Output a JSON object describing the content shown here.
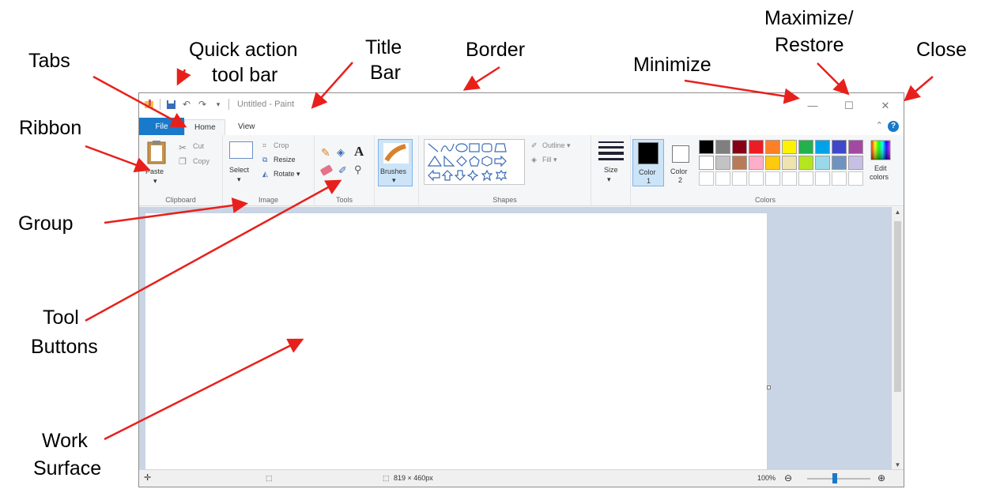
{
  "annotations": {
    "tabs": "Tabs",
    "quick_access_line1": "Quick action",
    "quick_access_line2": "tool bar",
    "title_bar_line1": "Title",
    "title_bar_line2": "Bar",
    "border": "Border",
    "minimize": "Minimize",
    "maximize_line1": "Maximize/",
    "maximize_line2": "Restore",
    "close": "Close",
    "ribbon": "Ribbon",
    "group": "Group",
    "tool_buttons_line1": "Tool",
    "tool_buttons_line2": "Buttons",
    "work_surface_line1": "Work",
    "work_surface_line2": "Surface"
  },
  "window": {
    "title": "Untitled - Paint",
    "minimize_glyph": "—",
    "maximize_glyph": "☐",
    "close_glyph": "✕"
  },
  "tabs": {
    "file": "File",
    "home": "Home",
    "view": "View"
  },
  "ribbon": {
    "clipboard": {
      "name": "Clipboard",
      "paste": "Paste",
      "cut": "Cut",
      "copy": "Copy"
    },
    "image": {
      "name": "Image",
      "select": "Select",
      "crop": "Crop",
      "resize": "Resize",
      "rotate": "Rotate ▾"
    },
    "tools": {
      "name": "Tools"
    },
    "brushes": {
      "label": "Brushes"
    },
    "shapes": {
      "name": "Shapes",
      "outline": "Outline ▾",
      "fill": "Fill ▾"
    },
    "size": {
      "label": "Size"
    },
    "colors": {
      "name": "Colors",
      "color1_line1": "Color",
      "color1_line2": "1",
      "color2_line1": "Color",
      "color2_line2": "2",
      "edit_line1": "Edit",
      "edit_line2": "colors",
      "color1": "#000000",
      "color2": "#ffffff",
      "palette_row1": [
        "#000000",
        "#7f7f7f",
        "#880015",
        "#ed1c24",
        "#ff7f27",
        "#fff200",
        "#22b14c",
        "#00a2e8",
        "#3f48cc",
        "#a349a4"
      ],
      "palette_row2": [
        "#ffffff",
        "#c3c3c3",
        "#b97a57",
        "#ffaec9",
        "#ffc90e",
        "#efe4b0",
        "#b5e61d",
        "#99d9ea",
        "#7092be",
        "#c8bfe7"
      ]
    }
  },
  "status": {
    "dimensions": "819 × 460px",
    "zoom": "100%"
  },
  "accent": "#1979ca",
  "arrow_color": "#e8201c"
}
